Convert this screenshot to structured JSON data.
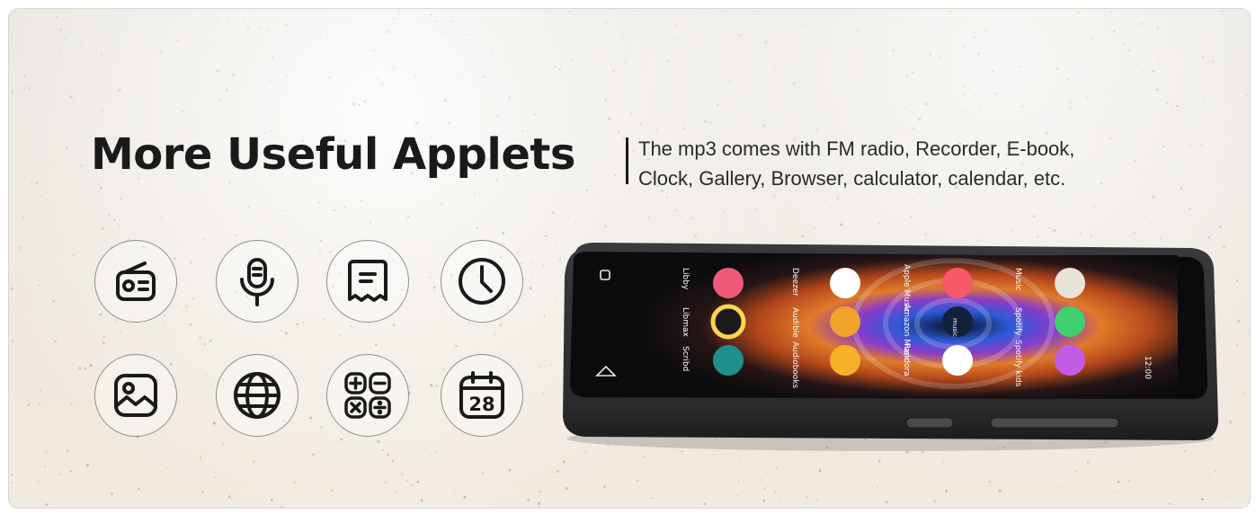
{
  "headline": "More Useful Applets",
  "subtitle_lines": [
    "The mp3 comes with FM radio, Recorder, E-book,",
    "Clock, Gallery, Browser, calculator, calendar, etc."
  ],
  "applet_icons": [
    {
      "name": "radio-icon"
    },
    {
      "name": "microphone-icon"
    },
    {
      "name": "ebook-icon"
    },
    {
      "name": "clock-icon"
    },
    {
      "name": "gallery-icon"
    },
    {
      "name": "browser-globe-icon"
    },
    {
      "name": "calculator-icon"
    },
    {
      "name": "calendar-icon",
      "day": "28"
    }
  ],
  "device_screen": {
    "apps": [
      "Libby",
      "Libmax",
      "Scribd",
      "Deezer",
      "Audible",
      "Audiobooks",
      "Apple Music",
      "Amazon Music",
      "Pandora",
      "Music",
      "Spotify",
      "Spotify kids"
    ],
    "status_time": "12:00",
    "center_icon_label": "music"
  },
  "colors": {
    "headline": "#1a1a1a",
    "subtitle": "#2a2a2a",
    "background": "#ece7df",
    "icon_stroke": "#1a1a1a",
    "icon_ring": "#8d8d8d",
    "device_body": "#2a2a2c"
  }
}
